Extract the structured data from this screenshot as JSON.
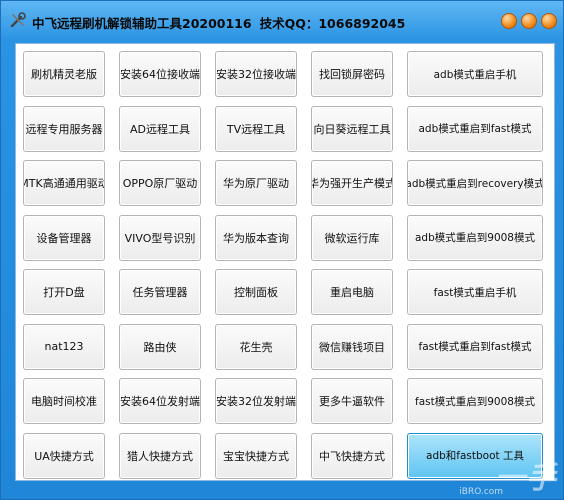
{
  "window": {
    "app_title": "中飞远程刷机解锁辅助工具20200116",
    "contact": "技术QQ：1066892045"
  },
  "colors": {
    "title_bar": "#2a93e3",
    "window_button": "#f08a1c",
    "active_button": "#5ec5f2"
  },
  "buttons": [
    "刷机精灵老版",
    "安装64位接收端",
    "安装32位接收端",
    "找回锁屏密码",
    "adb模式重启手机",
    "远程专用服务器",
    "AD远程工具",
    "TV远程工具",
    "向日葵远程工具",
    "adb模式重启到fast模式",
    "MTK高通通用驱动",
    "OPPO原厂驱动",
    "华为原厂驱动",
    "华为强开生产模式",
    "adb模式重启到recovery模式",
    "设备管理器",
    "VIVO型号识别",
    "华为版本查询",
    "微软运行库",
    "adb模式重启到9008模式",
    "打开D盘",
    "任务管理器",
    "控制面板",
    "重启电脑",
    "fast模式重启手机",
    "nat123",
    "路由侠",
    "花生壳",
    "微信赚钱项目",
    "fast模式重启到fast模式",
    "电脑时间校准",
    "安装64位发射端",
    "安装32位发射端",
    "更多牛逼软件",
    "fast模式重启到9008模式",
    "UA快捷方式",
    "猎人快捷方式",
    "宝宝快捷方式",
    "中飞快捷方式",
    "adb和fastboot 工具"
  ],
  "watermark": "一手",
  "watermark_sub": "iBRO.com"
}
